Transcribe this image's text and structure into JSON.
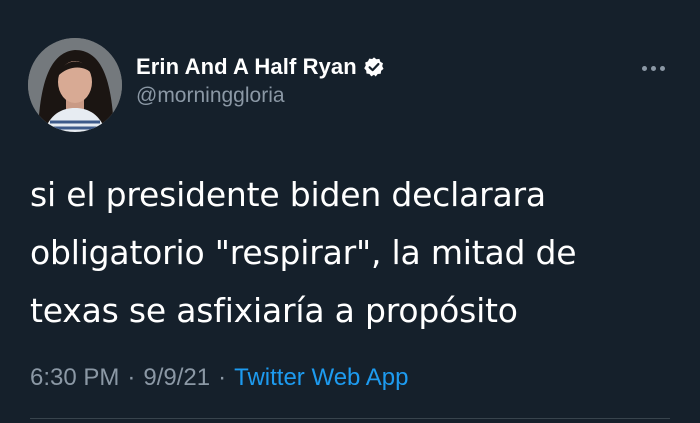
{
  "author": {
    "display_name": "Erin And A Half Ryan",
    "handle": "@morninggloria",
    "verified": true
  },
  "icons": {
    "verified": "verified-badge-icon",
    "more": "more-options-icon"
  },
  "tweet": {
    "text": "si el presidente biden declarara\nobligatorio \"respirar\", la mitad de\ntexas se asfixiaría a propósito"
  },
  "meta": {
    "time": "6:30 PM",
    "separator": "·",
    "date": "9/9/21",
    "source": "Twitter Web App"
  },
  "colors": {
    "background": "#15202b",
    "secondary_text": "#8b98a5",
    "accent": "#1d9bf0"
  }
}
